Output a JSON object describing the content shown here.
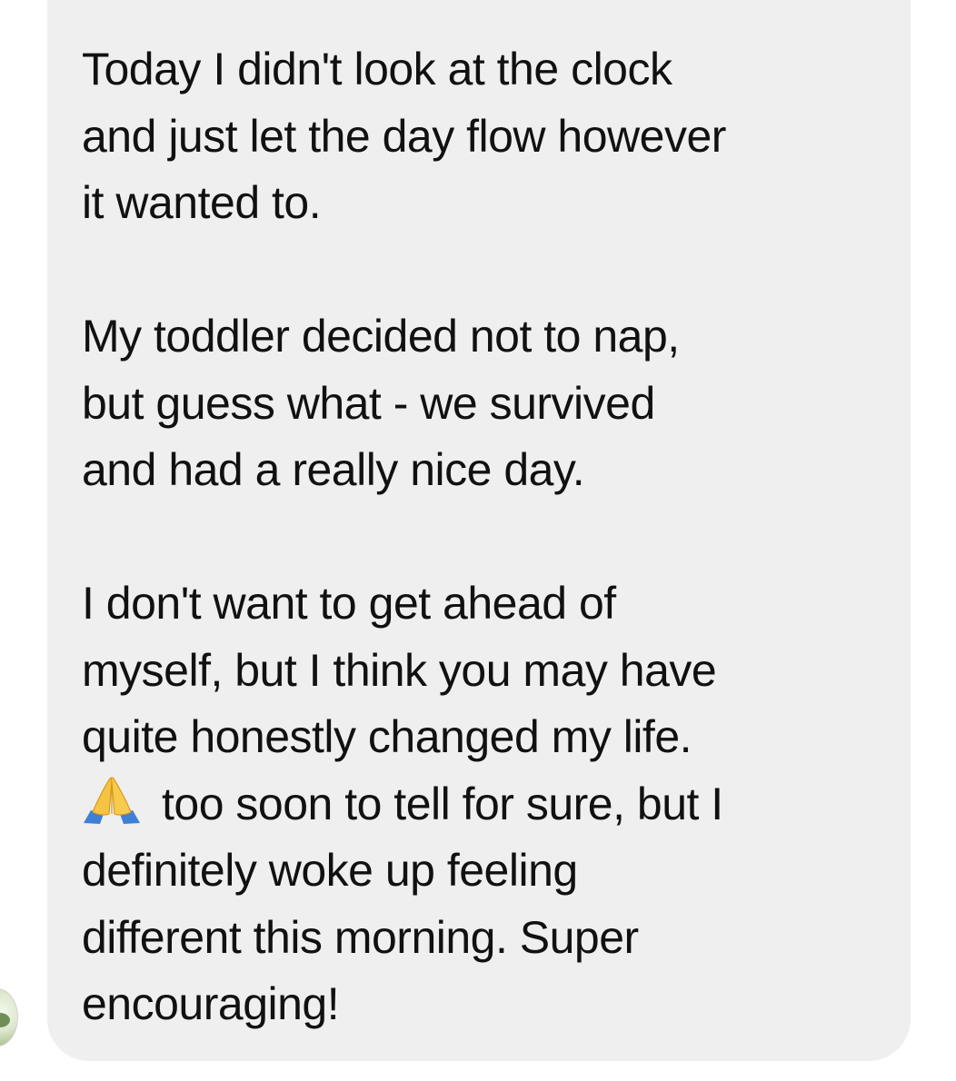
{
  "message": {
    "paragraphs": [
      {
        "lines": [
          "Today I didn't look at the clock",
          "and just let the day flow however",
          "it wanted to."
        ]
      },
      {
        "lines": [
          "My toddler decided not to nap,",
          "but guess what - we survived",
          "and had a really nice day."
        ]
      },
      {
        "lines": [
          "I don't want to get ahead of",
          "myself, but I think you may have",
          "quite honestly changed my life.",
          "too soon to tell for sure, but I",
          "definitely woke up feeling",
          "different this morning. Super",
          "encouraging!"
        ]
      }
    ],
    "emoji": "folded-hands-emoji",
    "bubble_color": "#efefef",
    "text_color": "#111111"
  },
  "sender": {
    "avatar_icon": "avatar-image"
  }
}
